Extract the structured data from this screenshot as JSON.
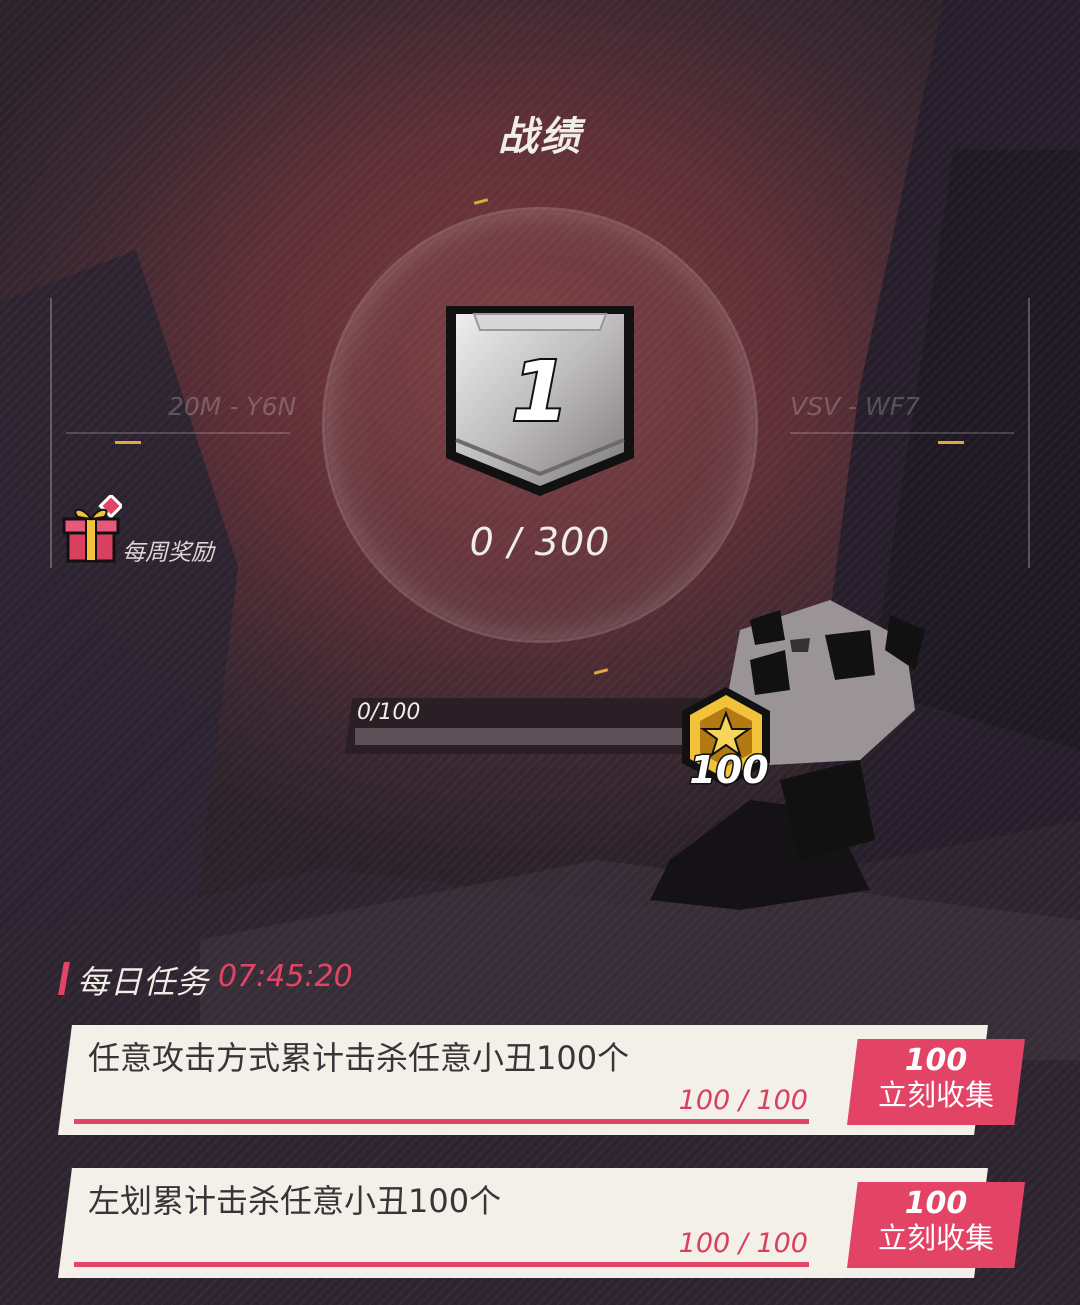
{
  "header": {
    "title": "战绩"
  },
  "rank": {
    "level": "1",
    "progress_text": "0 / 300"
  },
  "side": {
    "left_code": "20M - Y6N",
    "right_code": "VSV - WF7"
  },
  "weekly_reward": {
    "label": "每周奖励",
    "icon": "gift-icon"
  },
  "xp": {
    "label": "0/100",
    "fill_fraction": 0.0,
    "coin_value": "100",
    "coin_icon": "star-coin-icon"
  },
  "daily": {
    "title": "每日任务",
    "timer": "07:45:20",
    "tasks": [
      {
        "text": "任意攻击方式累计击杀任意小丑100个",
        "progress": "100 / 100",
        "reward": "100",
        "action": "立刻收集"
      },
      {
        "text": "左划累计击杀任意小丑100个",
        "progress": "100 / 100",
        "reward": "100",
        "action": "立刻收集"
      }
    ]
  },
  "colors": {
    "accent": "#e34465",
    "gold": "#e0a93c",
    "card": "#f3efe9"
  }
}
